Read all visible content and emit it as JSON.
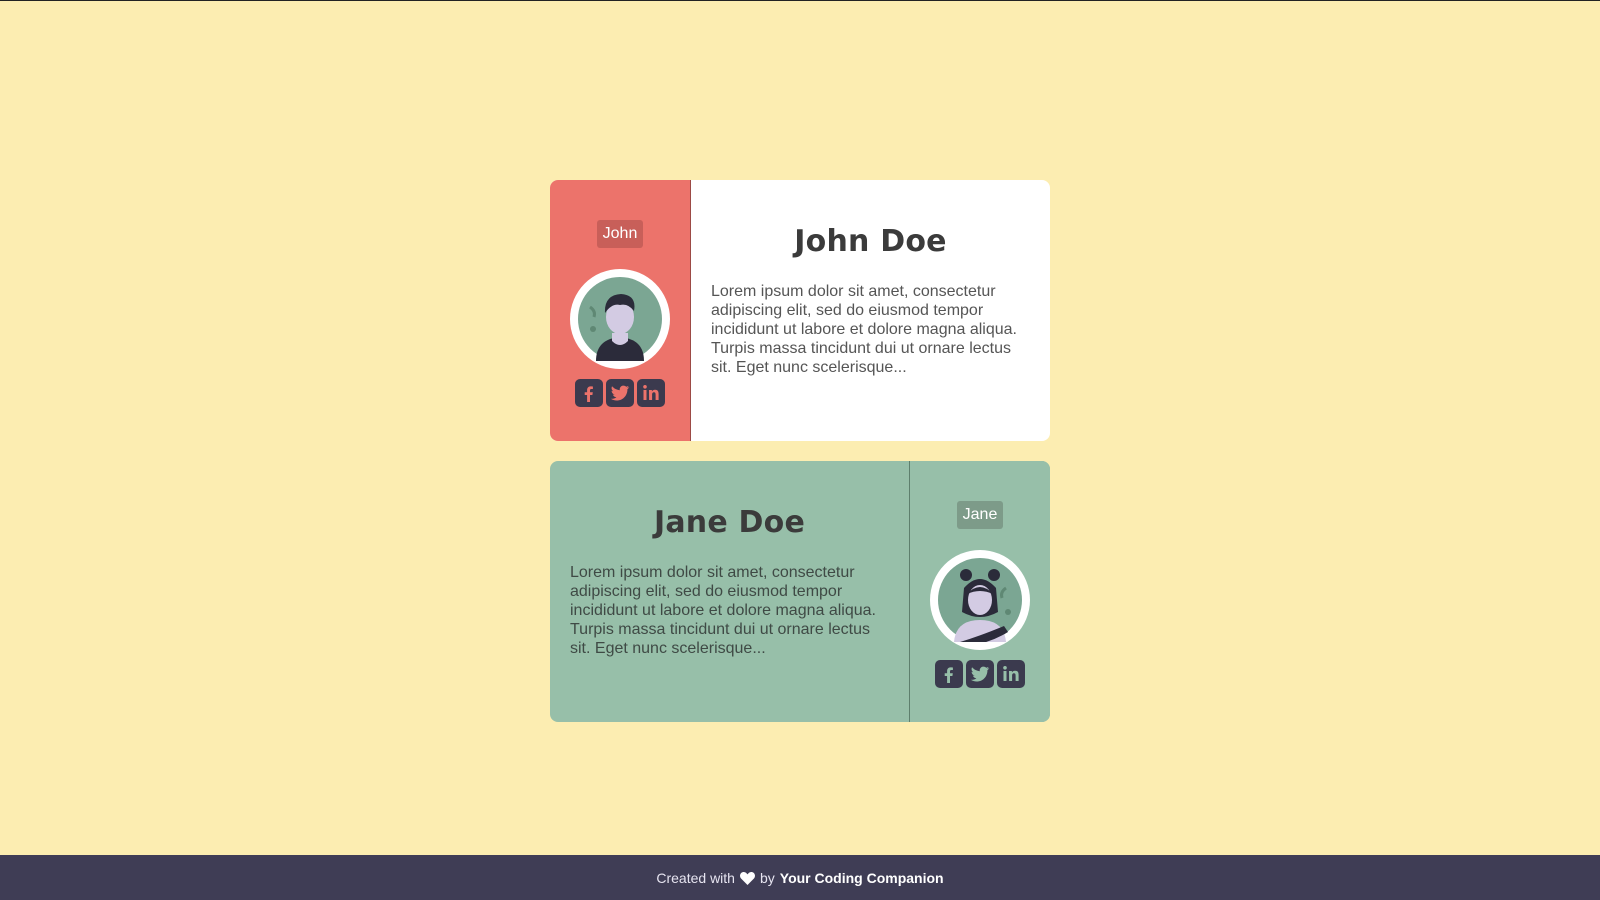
{
  "colors": {
    "page_background": "#fcedb1",
    "john_accent": "#ec736b",
    "jane_accent": "#97bfa9",
    "footer_background": "#3f3d55",
    "icon_dark": "#3b3a4e"
  },
  "cards": [
    {
      "tag": "John",
      "name": "John Doe",
      "bio": "Lorem ipsum dolor sit amet, consectetur adipiscing elit, sed do eiusmod tempor incididunt ut labore et dolore magna aliqua. Turpis massa tincidunt dui ut ornare lectus sit. Eget nunc scelerisque...",
      "avatar_icon": "male-avatar-icon",
      "socials": [
        "facebook-icon",
        "twitter-icon",
        "linkedin-icon"
      ]
    },
    {
      "tag": "Jane",
      "name": "Jane Doe",
      "bio": "Lorem ipsum dolor sit amet, consectetur adipiscing elit, sed do eiusmod tempor incididunt ut labore et dolore magna aliqua. Turpis massa tincidunt dui ut ornare lectus sit. Eget nunc scelerisque...",
      "avatar_icon": "female-avatar-icon",
      "socials": [
        "facebook-icon",
        "twitter-icon",
        "linkedin-icon"
      ]
    }
  ],
  "footer": {
    "created_with": "Created with",
    "heart_icon": "heart-icon",
    "by": "by",
    "brand": "Your Coding Companion"
  }
}
